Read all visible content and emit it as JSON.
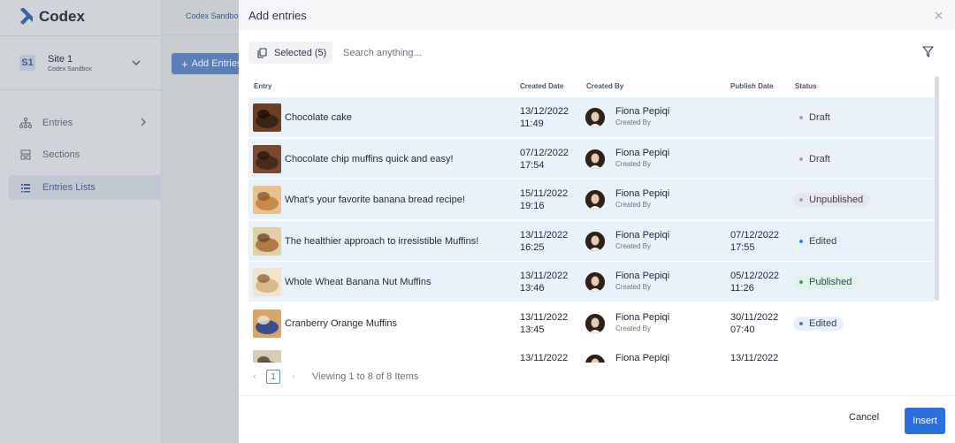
{
  "app": {
    "brand": "Codex",
    "site": {
      "badge": "S1",
      "name": "Site 1",
      "subtitle": "Codex Sandbox"
    },
    "nav": [
      {
        "label": "Entries"
      },
      {
        "label": "Sections"
      },
      {
        "label": "Entries Lists"
      }
    ],
    "breadcrumb": "Codex Sandbox",
    "add_entries_label": "Add Entries"
  },
  "modal": {
    "title": "Add entries",
    "selected_label": "Selected (5)",
    "search_placeholder": "Search anything...",
    "columns": {
      "entry": "Entry",
      "created_date": "Created Date",
      "created_by": "Created By",
      "publish_date": "Publish Date",
      "status": "Status"
    },
    "rows": [
      {
        "title": "Chocolate cake",
        "created_date": "13/12/2022",
        "created_time": "11:49",
        "author": "Fiona Pepiqi",
        "author_role": "Created By",
        "publish_date": "",
        "publish_time": "",
        "status": "Draft",
        "selected": true
      },
      {
        "title": "Chocolate chip muffins quick and easy!",
        "created_date": "07/12/2022",
        "created_time": "17:54",
        "author": "Fiona Pepiqi",
        "author_role": "Created By",
        "publish_date": "",
        "publish_time": "",
        "status": "Draft",
        "selected": true
      },
      {
        "title": "What's your favorite banana bread recipe!",
        "created_date": "15/11/2022",
        "created_time": "19:16",
        "author": "Fiona Pepiqi",
        "author_role": "Created By",
        "publish_date": "",
        "publish_time": "",
        "status": "Unpublished",
        "selected": true
      },
      {
        "title": "The healthier approach to irresistible Muffins!",
        "created_date": "13/11/2022",
        "created_time": "16:25",
        "author": "Fiona Pepiqi",
        "author_role": "Created By",
        "publish_date": "07/12/2022",
        "publish_time": "17:55",
        "status": "Edited",
        "selected": true
      },
      {
        "title": "Whole Wheat Banana Nut Muffins",
        "created_date": "13/11/2022",
        "created_time": "13:46",
        "author": "Fiona Pepiqi",
        "author_role": "Created By",
        "publish_date": "05/12/2022",
        "publish_time": "11:26",
        "status": "Published",
        "selected": true
      },
      {
        "title": "Cranberry Orange Muffins",
        "created_date": "13/11/2022",
        "created_time": "13:45",
        "author": "Fiona Pepiqi",
        "author_role": "Created By",
        "publish_date": "30/11/2022",
        "publish_time": "07:40",
        "status": "Edited",
        "selected": false
      },
      {
        "title": "",
        "created_date": "13/11/2022",
        "created_time": "",
        "author": "Fiona Pepiqi",
        "author_role": "",
        "publish_date": "13/11/2022",
        "publish_time": "",
        "status": "",
        "selected": false
      }
    ],
    "pagination": {
      "current_page": "1",
      "info": "Viewing 1 to 8 of 8 Items"
    },
    "cancel_label": "Cancel",
    "insert_label": "Insert"
  },
  "colors": {
    "primary": "#2a6fdb",
    "selected_row": "#e9f1fb",
    "published": "#2fa35a",
    "edited": "#3b7bd4",
    "draft": "#9ca3af"
  },
  "icons": {
    "selected": "copy-icon",
    "filter": "filter-icon",
    "close": "close-icon"
  }
}
